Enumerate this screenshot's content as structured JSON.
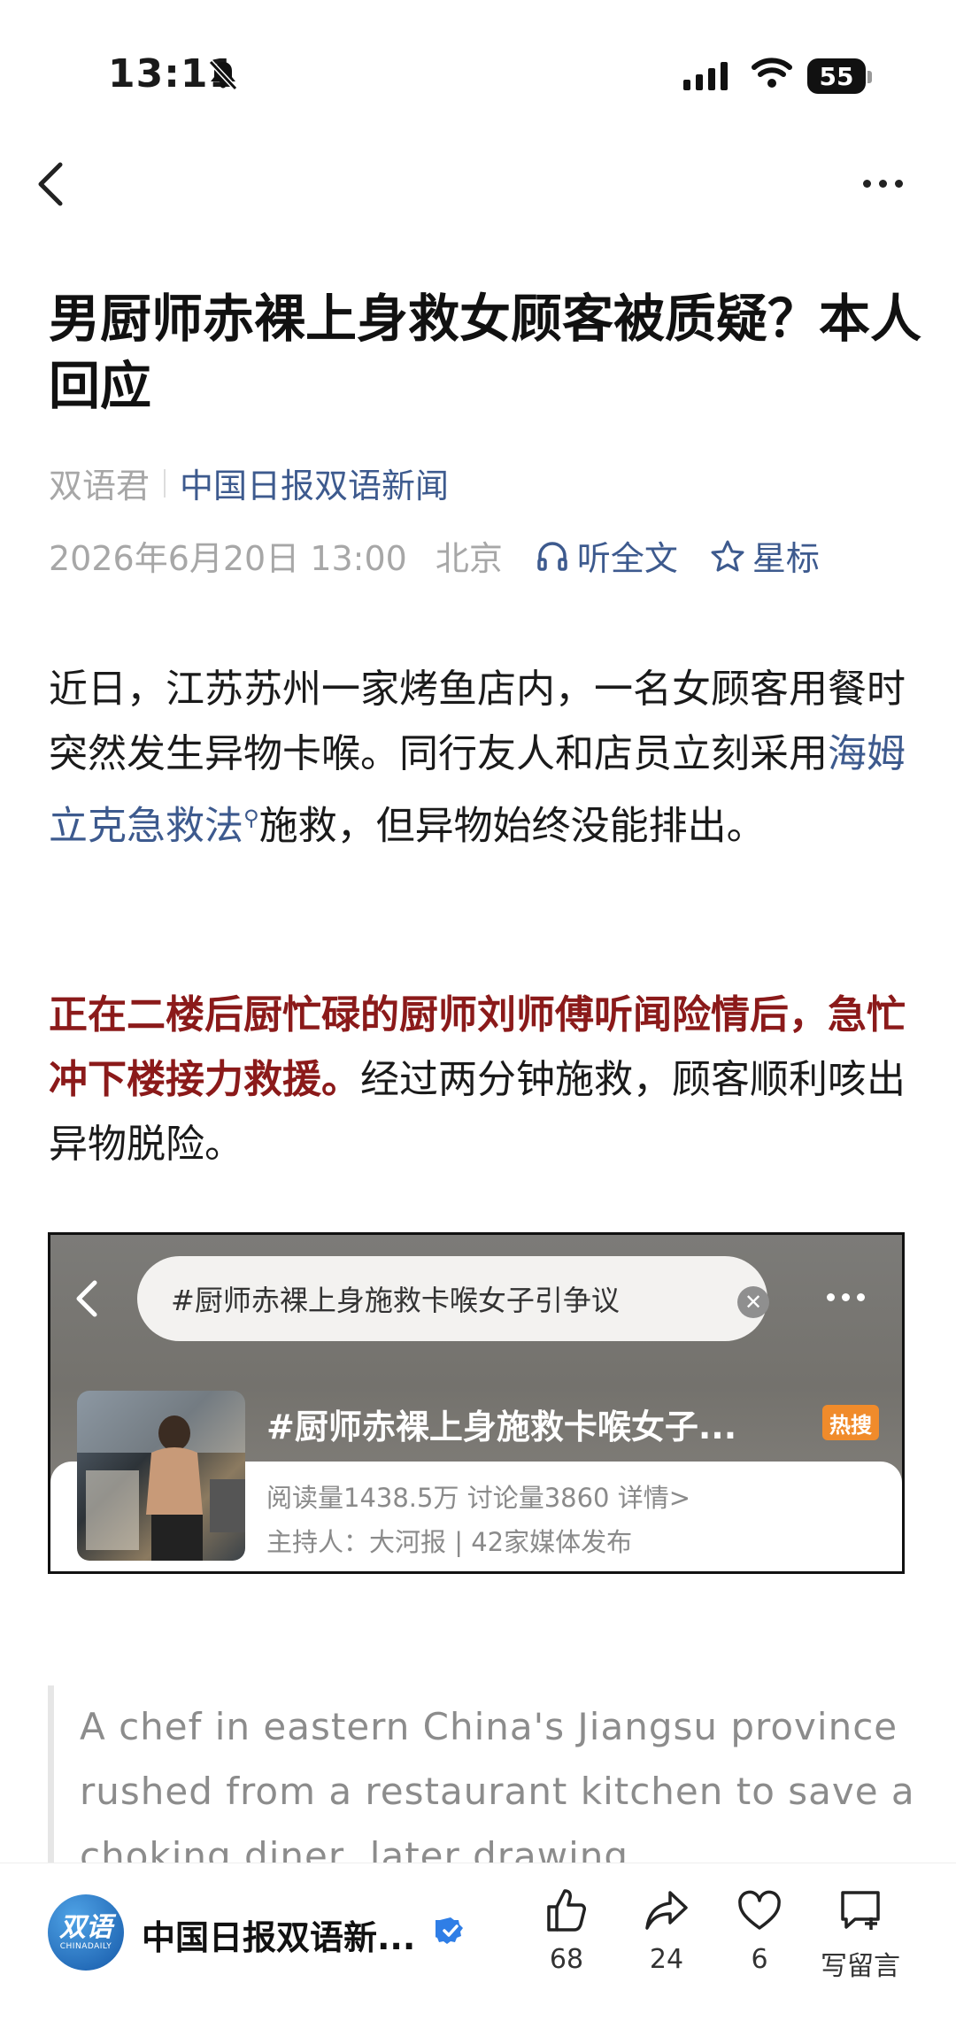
{
  "status_bar": {
    "time": "13:11",
    "battery": "55"
  },
  "article": {
    "title": "男厨师赤裸上身救女顾客被质疑？本人回应",
    "author": "双语君",
    "source": "中国日报双语新闻",
    "date": "2026年6月20日 13:00",
    "location": "北京",
    "listen_label": "听全文",
    "star_label": "星标",
    "p1_a": "近日，江苏苏州一家烤鱼店内，一名女顾客用餐时突然发生异物卡喉。同行友人和店员立刻采用",
    "p1_link": "海姆立克急救法",
    "p1_b": "施救，但异物始终没能排出。",
    "p2_highlight": "正在二楼后厨忙碌的厨师刘师傅听闻险情后，急忙冲下楼接力救援。",
    "p2_rest": "经过两分钟施救，顾客顺利咳出异物脱险。",
    "quote": "A chef in eastern China's Jiangsu province rushed from a restaurant kitchen to save a choking diner, later drawing"
  },
  "embed": {
    "search_text": "#厨师赤裸上身施救卡喉女子引争议",
    "topic": "#厨师赤裸上身施救卡喉女子...",
    "hot_badge": "热搜",
    "stats": "阅读量1438.5万  讨论量3860  详情>",
    "host": "主持人：大河报 | 42家媒体发布"
  },
  "bottom": {
    "logo_text": "双语",
    "logo_sub": "CHINADAILY",
    "channel": "中国日报双语新...",
    "likes": "68",
    "shares": "24",
    "favorites": "6",
    "comment_label": "写留言"
  },
  "colors": {
    "link": "#3d5a8e",
    "highlight": "#8b1a1a",
    "badge": "#f08b2b"
  }
}
